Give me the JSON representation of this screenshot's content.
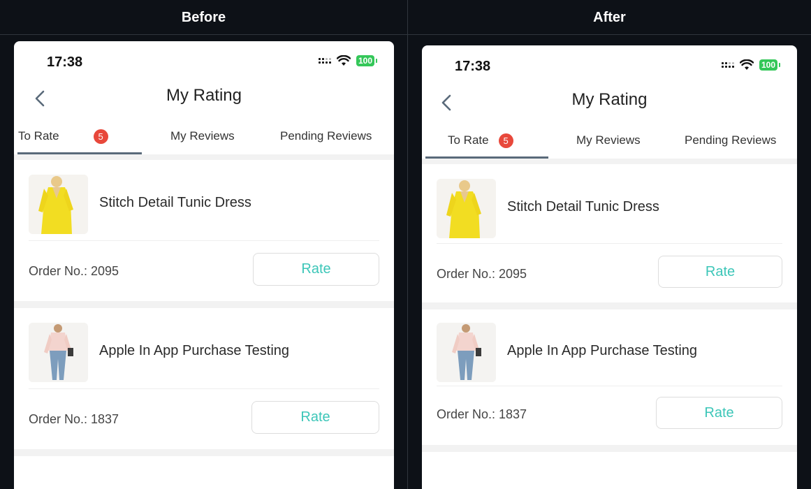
{
  "labels": {
    "before": "Before",
    "after": "After"
  },
  "status": {
    "time": "17:38",
    "battery": "100"
  },
  "nav": {
    "title": "My Rating"
  },
  "tabs": [
    {
      "label": "To Rate",
      "badge": "5",
      "active": true
    },
    {
      "label": "My Reviews"
    },
    {
      "label": "Pending Reviews"
    }
  ],
  "items": [
    {
      "name": "Stitch Detail Tunic Dress",
      "order": "Order No.: 2095",
      "rate_label": "Rate"
    },
    {
      "name": "Apple In App Purchase Testing",
      "order": "Order No.: 1837",
      "rate_label": "Rate"
    }
  ],
  "colors": {
    "accent": "#3cc6b8",
    "badge": "#e8483b",
    "tab_active": "#5a6a7a",
    "battery": "#34c759"
  }
}
